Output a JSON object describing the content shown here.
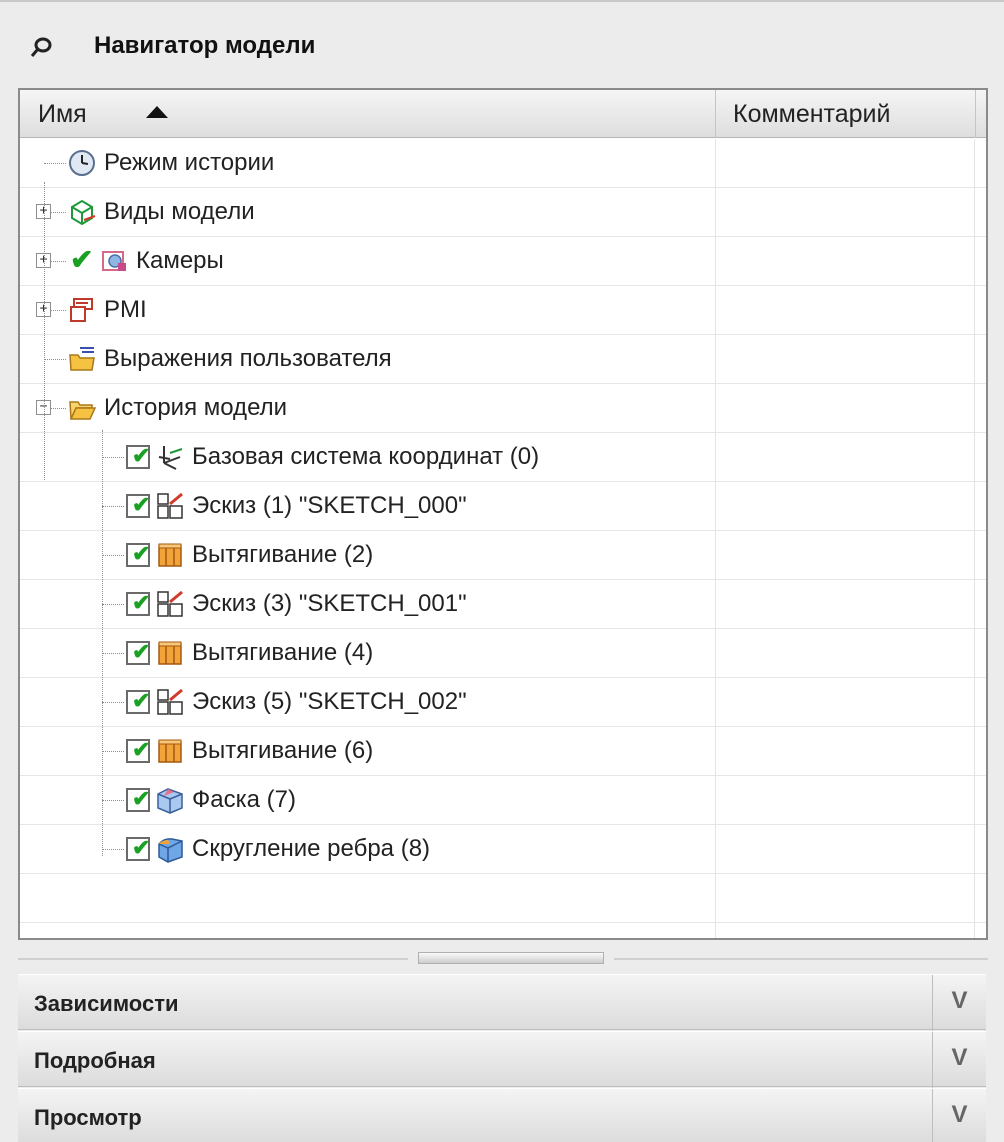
{
  "panel": {
    "title": "Навигатор модели",
    "pin_icon": "pin-icon"
  },
  "tree": {
    "columns": {
      "name": "Имя",
      "comment": "Комментарий",
      "sort": "ascending"
    },
    "rows": [
      {
        "label": "Режим истории",
        "icon": "clock-icon",
        "level": 0,
        "expander": "none",
        "checked": null
      },
      {
        "label": "Виды модели",
        "icon": "model-views-icon",
        "level": 0,
        "expander": "+",
        "checked": null
      },
      {
        "label": "Камеры",
        "icon": "camera-icon",
        "level": 0,
        "expander": "+",
        "checked": "tick"
      },
      {
        "label": "PMI",
        "icon": "pmi-icon",
        "level": 0,
        "expander": "+",
        "checked": null
      },
      {
        "label": "Выражения пользователя",
        "icon": "folder-expressions-icon",
        "level": 0,
        "expander": "none",
        "checked": null
      },
      {
        "label": "История модели",
        "icon": "folder-open-icon",
        "level": 0,
        "expander": "-",
        "checked": null
      },
      {
        "label": "Базовая система координат (0)",
        "icon": "datum-csys-icon",
        "level": 1,
        "checked": true
      },
      {
        "label": "Эскиз (1) \"SKETCH_000\"",
        "icon": "sketch-icon",
        "level": 1,
        "checked": true
      },
      {
        "label": "Вытягивание (2)",
        "icon": "extrude-icon",
        "level": 1,
        "checked": true
      },
      {
        "label": "Эскиз (3) \"SKETCH_001\"",
        "icon": "sketch-icon",
        "level": 1,
        "checked": true
      },
      {
        "label": "Вытягивание (4)",
        "icon": "extrude-icon",
        "level": 1,
        "checked": true
      },
      {
        "label": "Эскиз (5) \"SKETCH_002\"",
        "icon": "sketch-icon",
        "level": 1,
        "checked": true
      },
      {
        "label": "Вытягивание (6)",
        "icon": "extrude-icon",
        "level": 1,
        "checked": true
      },
      {
        "label": "Фаска (7)",
        "icon": "chamfer-icon",
        "level": 1,
        "checked": true
      },
      {
        "label": "Скругление ребра (8)",
        "icon": "edge-blend-icon",
        "level": 1,
        "checked": true
      }
    ]
  },
  "sections": [
    {
      "label": "Зависимости",
      "icon": "chevron-down-icon"
    },
    {
      "label": "Подробная",
      "icon": "chevron-down-icon"
    },
    {
      "label": "Просмотр",
      "icon": "chevron-down-icon"
    }
  ],
  "colors": {
    "check_green": "#1aa022",
    "folder_yellow": "#f5c242",
    "extrude_orange": "#e8912a",
    "sketch_red": "#d23b2a",
    "blend_blue": "#3b7fd6"
  }
}
